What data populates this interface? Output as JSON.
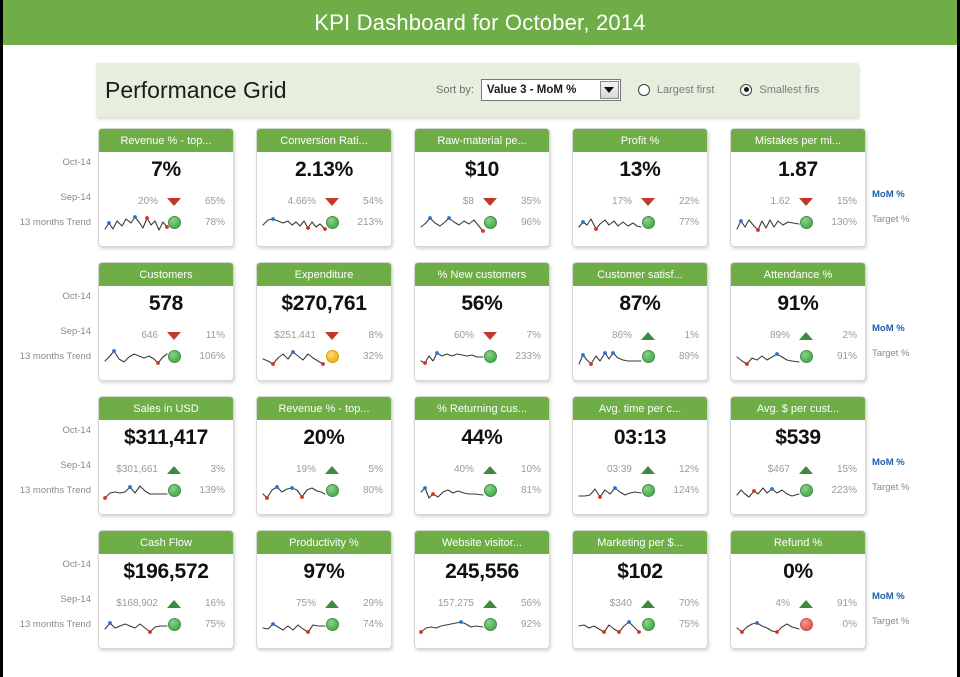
{
  "header": {
    "title": "KPI Dashboard for October, 2014",
    "bg_color": "#6fad46"
  },
  "panel": {
    "title": "Performance Grid",
    "sort_label": "Sort by:",
    "sort_value": "Value 3 - MoM %",
    "dropdown_icon": "chevron-down-icon",
    "options": [
      {
        "label": "Largest first",
        "selected": false
      },
      {
        "label": "Smallest firs",
        "selected": true
      }
    ]
  },
  "row_labels": {
    "current": "Oct-14",
    "previous": "Sep-14",
    "trend": "13 months Trend"
  },
  "right_labels": {
    "mom": "MoM %",
    "target": "Target %",
    "mom_color": "#1f5fa9"
  },
  "cards": [
    {
      "title": "Revenue % - top...",
      "value": "7%",
      "prev": "20%",
      "dir": "down",
      "mom": "65%",
      "status": "green",
      "target": "78%",
      "spark": "2,20 6,14 10,20 14,12 19,17 23,10 28,14 32,8 36,13 40,19 44,9 48,16 52,12 56,21 60,13 64,18",
      "markers": [
        {
          "x": 6,
          "y": 14,
          "c": "blue"
        },
        {
          "x": 32,
          "y": 8,
          "c": "blue"
        },
        {
          "x": 44,
          "y": 9,
          "c": "red"
        },
        {
          "x": 64,
          "y": 18,
          "c": "red"
        }
      ]
    },
    {
      "title": "Conversion Rati...",
      "value": "2.13%",
      "prev": "4.66%",
      "dir": "down",
      "mom": "54%",
      "status": "green",
      "target": "213%",
      "spark": "2,16 7,11 12,10 17,12 22,14 27,12 31,16 35,13 39,17 43,12 47,19 51,13 55,18 59,15 64,20",
      "markers": [
        {
          "x": 12,
          "y": 10,
          "c": "blue"
        },
        {
          "x": 47,
          "y": 19,
          "c": "red"
        },
        {
          "x": 64,
          "y": 20,
          "c": "red"
        }
      ]
    },
    {
      "title": "Raw-material pe...",
      "value": "$10",
      "prev": "$8",
      "dir": "down",
      "mom": "35%",
      "status": "green",
      "target": "96%",
      "spark": "2,18 7,14 11,9 16,14 21,17 26,13 30,9 35,13 40,16 45,12 50,15 55,11 59,16 64,22",
      "markers": [
        {
          "x": 11,
          "y": 9,
          "c": "blue"
        },
        {
          "x": 30,
          "y": 9,
          "c": "blue"
        },
        {
          "x": 64,
          "y": 22,
          "c": "red"
        }
      ]
    },
    {
      "title": "Profit %",
      "value": "13%",
      "prev": "17%",
      "dir": "down",
      "mom": "22%",
      "status": "green",
      "target": "77%",
      "spark": "2,18 6,13 10,16 14,10 19,20 23,15 28,11 32,16 37,12 41,17 46,13 51,17 56,14 60,17 64,18",
      "markers": [
        {
          "x": 6,
          "y": 13,
          "c": "blue"
        },
        {
          "x": 19,
          "y": 20,
          "c": "red"
        }
      ]
    },
    {
      "title": "Mistakes per mi...",
      "value": "1.87",
      "prev": "1.62",
      "dir": "down",
      "mom": "15%",
      "status": "green",
      "target": "130%",
      "spark": "2,20 6,12 10,18 14,11 19,17 23,21 27,12 31,19 35,11 39,18 43,12 48,16 53,13 58,14 64,15",
      "markers": [
        {
          "x": 6,
          "y": 12,
          "c": "blue"
        },
        {
          "x": 23,
          "y": 21,
          "c": "red"
        }
      ]
    },
    {
      "title": "Customers",
      "value": "578",
      "prev": "646",
      "dir": "down",
      "mom": "11%",
      "status": "green",
      "target": "106%",
      "spark": "2,18 7,13 11,8 16,16 21,19 26,14 31,11 36,13 41,15 46,13 51,16 55,20 60,14 64,11",
      "markers": [
        {
          "x": 11,
          "y": 8,
          "c": "blue"
        },
        {
          "x": 55,
          "y": 20,
          "c": "red"
        }
      ]
    },
    {
      "title": "Expenditure",
      "value": "$270,761",
      "prev": "$251,441",
      "dir": "down",
      "mom": "8%",
      "status": "amber",
      "target": "32%",
      "spark": "2,16 7,18 12,21 17,15 22,11 27,16 32,9 37,13 42,17 47,11 52,15 57,18 62,21",
      "markers": [
        {
          "x": 12,
          "y": 21,
          "c": "red"
        },
        {
          "x": 32,
          "y": 9,
          "c": "blue"
        },
        {
          "x": 62,
          "y": 21,
          "c": "red"
        }
      ]
    },
    {
      "title": "% New customers",
      "value": "56%",
      "prev": "60%",
      "dir": "down",
      "mom": "7%",
      "status": "green",
      "target": "233%",
      "spark": "2,18 6,20 10,13 14,18 18,10 23,13 28,11 33,13 38,11 43,12 48,13 53,12 58,14 64,14",
      "markers": [
        {
          "x": 6,
          "y": 20,
          "c": "red"
        },
        {
          "x": 18,
          "y": 10,
          "c": "blue"
        }
      ]
    },
    {
      "title": "Customer satisf...",
      "value": "87%",
      "prev": "86%",
      "dir": "up",
      "mom": "1%",
      "status": "green",
      "target": "89%",
      "spark": "2,21 6,12 10,17 14,21 19,13 23,18 28,10 32,16 36,10 41,15 46,17 51,18 56,18 64,18",
      "markers": [
        {
          "x": 6,
          "y": 12,
          "c": "blue"
        },
        {
          "x": 14,
          "y": 21,
          "c": "red"
        },
        {
          "x": 28,
          "y": 10,
          "c": "blue"
        },
        {
          "x": 36,
          "y": 10,
          "c": "blue"
        }
      ]
    },
    {
      "title": "Attendance %",
      "value": "91%",
      "prev": "89%",
      "dir": "up",
      "mom": "2%",
      "status": "green",
      "target": "91%",
      "spark": "2,14 7,18 12,21 17,15 22,17 27,13 32,17 37,14 42,11 47,14 52,17 57,18 64,19",
      "markers": [
        {
          "x": 12,
          "y": 21,
          "c": "red"
        },
        {
          "x": 42,
          "y": 11,
          "c": "blue"
        }
      ]
    },
    {
      "title": "Sales in USD",
      "value": "$311,417",
      "prev": "$301,661",
      "dir": "up",
      "mom": "3%",
      "status": "green",
      "target": "139%",
      "spark": "2,21 7,16 12,15 17,16 22,15 27,10 32,16 37,9 42,14 47,17 52,17 57,17 64,17",
      "markers": [
        {
          "x": 2,
          "y": 21,
          "c": "red"
        },
        {
          "x": 27,
          "y": 10,
          "c": "blue"
        }
      ]
    },
    {
      "title": "Revenue % - top...",
      "value": "20%",
      "prev": "19%",
      "dir": "up",
      "mom": "5%",
      "status": "green",
      "target": "80%",
      "spark": "2,17 6,21 11,13 16,10 21,15 26,12 31,11 36,13 41,20 46,13 51,11 56,14 60,15 64,17",
      "markers": [
        {
          "x": 6,
          "y": 21,
          "c": "red"
        },
        {
          "x": 16,
          "y": 10,
          "c": "blue"
        },
        {
          "x": 31,
          "y": 11,
          "c": "blue"
        },
        {
          "x": 41,
          "y": 20,
          "c": "red"
        }
      ]
    },
    {
      "title": "% Returning cus...",
      "value": "44%",
      "prev": "40%",
      "dir": "up",
      "mom": "10%",
      "status": "green",
      "target": "81%",
      "spark": "2,15 6,11 10,21 14,17 19,20 24,15 29,13 34,16 39,14 45,16 50,17 56,17 64,18",
      "markers": [
        {
          "x": 6,
          "y": 11,
          "c": "blue"
        },
        {
          "x": 14,
          "y": 17,
          "c": "red"
        }
      ]
    },
    {
      "title": "Avg. time per c...",
      "value": "03:13",
      "prev": "03:39",
      "dir": "up",
      "mom": "12%",
      "status": "green",
      "target": "124%",
      "spark": "2,19 8,19 13,18 18,12 23,20 28,13 33,17 38,11 43,15 48,18 53,16 58,15 64,16",
      "markers": [
        {
          "x": 23,
          "y": 20,
          "c": "red"
        },
        {
          "x": 38,
          "y": 11,
          "c": "blue"
        }
      ]
    },
    {
      "title": "Avg. $ per cust...",
      "value": "$539",
      "prev": "$467",
      "dir": "up",
      "mom": "15%",
      "status": "green",
      "target": "223%",
      "spark": "2,18 6,13 10,17 14,20 19,14 23,17 28,11 32,16 37,12 42,16 47,13 52,17 57,19 64,17",
      "markers": [
        {
          "x": 19,
          "y": 14,
          "c": "red"
        },
        {
          "x": 37,
          "y": 12,
          "c": "blue"
        }
      ]
    },
    {
      "title": "Cash Flow",
      "value": "$196,572",
      "prev": "$168,902",
      "dir": "up",
      "mom": "16%",
      "status": "green",
      "target": "75%",
      "spark": "2,18 7,12 12,17 17,15 22,13 27,15 32,17 37,13 42,17 47,21 52,16 57,15 64,15",
      "markers": [
        {
          "x": 7,
          "y": 12,
          "c": "blue"
        },
        {
          "x": 47,
          "y": 21,
          "c": "red"
        }
      ]
    },
    {
      "title": "Productivity %",
      "value": "97%",
      "prev": "75%",
      "dir": "up",
      "mom": "29%",
      "status": "green",
      "target": "74%",
      "spark": "2,17 7,18 12,13 17,16 22,19 27,15 32,19 37,14 42,18 47,21 52,14 57,15 64,15",
      "markers": [
        {
          "x": 12,
          "y": 13,
          "c": "blue"
        },
        {
          "x": 47,
          "y": 21,
          "c": "red"
        }
      ]
    },
    {
      "title": "Website visitor...",
      "value": "245,556",
      "prev": "157,275",
      "dir": "up",
      "mom": "56%",
      "status": "green",
      "target": "92%",
      "spark": "2,21 7,17 12,16 17,17 22,15 27,14 32,13 37,12 42,11 47,13 52,16 57,15 64,16",
      "markers": [
        {
          "x": 2,
          "y": 21,
          "c": "red"
        },
        {
          "x": 42,
          "y": 11,
          "c": "blue"
        }
      ]
    },
    {
      "title": "Marketing per $...",
      "value": "$102",
      "prev": "$340",
      "dir": "up",
      "mom": "70%",
      "status": "green",
      "target": "75%",
      "spark": "2,15 7,14 12,17 17,15 22,18 27,21 32,14 37,18 42,21 47,15 52,11 57,16 62,21",
      "markers": [
        {
          "x": 27,
          "y": 21,
          "c": "red"
        },
        {
          "x": 42,
          "y": 21,
          "c": "red"
        },
        {
          "x": 52,
          "y": 11,
          "c": "blue"
        },
        {
          "x": 62,
          "y": 21,
          "c": "red"
        }
      ]
    },
    {
      "title": "Refund %",
      "value": "0%",
      "prev": "4%",
      "dir": "up",
      "mom": "91%",
      "status": "red",
      "target": "0%",
      "spark": "2,17 7,21 12,16 17,13 22,12 27,15 32,17 37,20 42,21 47,16 52,13 57,16 64,18",
      "markers": [
        {
          "x": 7,
          "y": 21,
          "c": "red"
        },
        {
          "x": 22,
          "y": 12,
          "c": "blue"
        },
        {
          "x": 42,
          "y": 21,
          "c": "red"
        }
      ]
    }
  ]
}
